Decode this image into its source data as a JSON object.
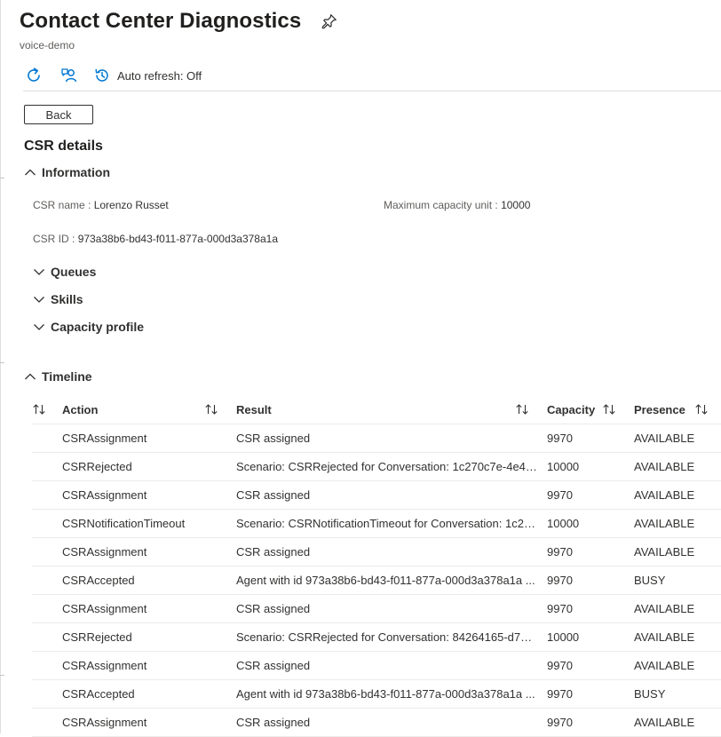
{
  "header": {
    "title": "Contact Center Diagnostics",
    "subtitle": "voice-demo"
  },
  "toolbar": {
    "refresh_icon": "refresh-icon",
    "feedback_icon": "feedback-icon",
    "auto_refresh_label": "Auto refresh: Off"
  },
  "back_label": "Back",
  "section_title": "CSR details",
  "information": {
    "header": "Information",
    "csr_name_label": "CSR name :",
    "csr_name_value": "Lorenzo Russet",
    "max_capacity_label": "Maximum capacity unit :",
    "max_capacity_value": "10000",
    "csr_id_label": "CSR ID :",
    "csr_id_value": "973a38b6-bd43-f011-877a-000d3a378a1a"
  },
  "collapsibles": {
    "queues": "Queues",
    "skills": "Skills",
    "capacity_profile": "Capacity profile"
  },
  "timeline": {
    "header": "Timeline",
    "columns": {
      "action": "Action",
      "result": "Result",
      "capacity": "Capacity",
      "presence": "Presence"
    },
    "rows": [
      {
        "action": "CSRAssignment",
        "result": "CSR assigned",
        "capacity": "9970",
        "presence": "AVAILABLE"
      },
      {
        "action": "CSRRejected",
        "result": "Scenario: CSRRejected for Conversation: 1c270c7e-4e41-...",
        "capacity": "10000",
        "presence": "AVAILABLE"
      },
      {
        "action": "CSRAssignment",
        "result": "CSR assigned",
        "capacity": "9970",
        "presence": "AVAILABLE"
      },
      {
        "action": "CSRNotificationTimeout",
        "result": "Scenario: CSRNotificationTimeout for Conversation: 1c27...",
        "capacity": "10000",
        "presence": "AVAILABLE"
      },
      {
        "action": "CSRAssignment",
        "result": "CSR assigned",
        "capacity": "9970",
        "presence": "AVAILABLE"
      },
      {
        "action": "CSRAccepted",
        "result": "Agent with id 973a38b6-bd43-f011-877a-000d3a378a1a ...",
        "capacity": "9970",
        "presence": "BUSY"
      },
      {
        "action": "CSRAssignment",
        "result": "CSR assigned",
        "capacity": "9970",
        "presence": "AVAILABLE"
      },
      {
        "action": "CSRRejected",
        "result": "Scenario: CSRRejected for Conversation: 84264165-d73d-...",
        "capacity": "10000",
        "presence": "AVAILABLE"
      },
      {
        "action": "CSRAssignment",
        "result": "CSR assigned",
        "capacity": "9970",
        "presence": "AVAILABLE"
      },
      {
        "action": "CSRAccepted",
        "result": "Agent with id 973a38b6-bd43-f011-877a-000d3a378a1a ...",
        "capacity": "9970",
        "presence": "BUSY"
      },
      {
        "action": "CSRAssignment",
        "result": "CSR assigned",
        "capacity": "9970",
        "presence": "AVAILABLE"
      }
    ]
  },
  "colors": {
    "accent": "#0078d4",
    "text": "#323130",
    "muted": "#605e5c",
    "border": "#edebe9"
  }
}
